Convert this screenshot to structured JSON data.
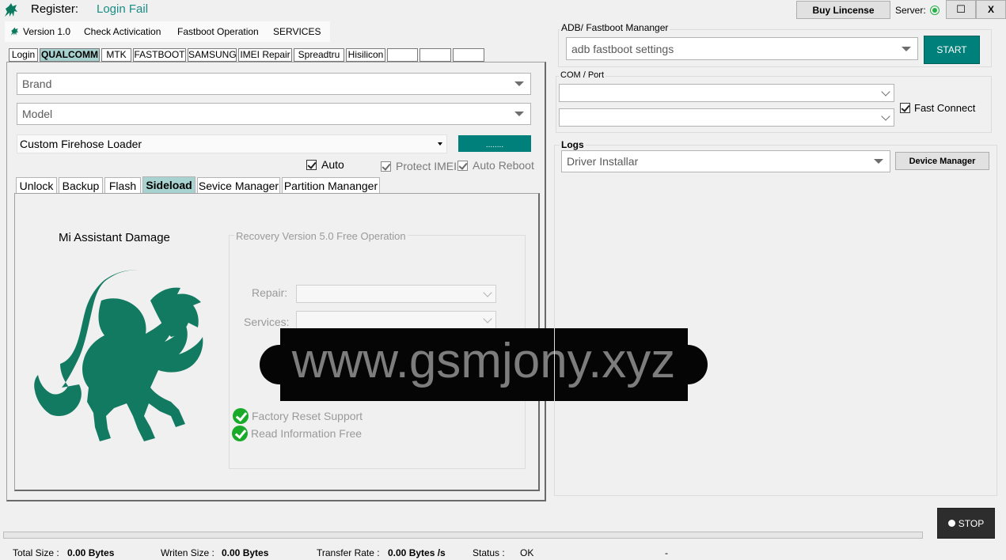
{
  "header": {
    "register_label": "Register:",
    "register_status": "Login Fail",
    "buy_license": "Buy Lincense",
    "server_label": "Server:",
    "maximize": "☐",
    "close": "X"
  },
  "menu": {
    "version": "Version 1.0",
    "check": "Check Activication",
    "fastboot": "Fastboot Operation",
    "services": "SERVICES"
  },
  "tabs": [
    "Login",
    "QUALCOMM",
    "MTK",
    "FASTBOOT",
    "SAMSUNG",
    "IMEI Repair",
    "Spreadtru",
    "Hisilicon",
    "",
    "",
    ""
  ],
  "left": {
    "brand_placeholder": "Brand",
    "model_placeholder": "Model",
    "loader_value": "Custom Firehose Loader",
    "browse": "........",
    "auto": "Auto",
    "protect_imei": "Protect IMEI",
    "auto_reboot": "Auto Reboot"
  },
  "subtabs": [
    "Unlock",
    "Backup",
    "Flash",
    "Sideload",
    "Sevice Manager",
    "Partition Mananger"
  ],
  "sideload": {
    "title": "Mi Assistant Damage",
    "group_title": "Recovery Version 5.0 Free Operation",
    "repair_label": "Repair:",
    "services_label": "Services:",
    "features": [
      "Factory Reset Support",
      "Read Information Free"
    ]
  },
  "watermark": "www.gsmjony.xyz",
  "right": {
    "adb_title": "ADB/ Fastboot Mananger",
    "adb_value": "adb fastboot settings",
    "start": "START",
    "com_title": "COM / Port",
    "fast_connect": "Fast Connect",
    "logs_title": "Logs",
    "logs_value": "Driver Installar",
    "device_manager": "Device Manager"
  },
  "stop": "STOP",
  "status": {
    "total_label": "Total Size :",
    "total_value": "0.00 Bytes",
    "written_label": "Writen Size :",
    "written_value": "0.00 Bytes",
    "rate_label": "Transfer Rate :",
    "rate_value": "0.00 Bytes /s",
    "status_label": "Status :",
    "status_value": "OK",
    "dash": "-"
  },
  "colors": {
    "accent": "#00807a",
    "tab_selected": "#a7d2cf",
    "link": "#1a8c84"
  },
  "progress": 0
}
